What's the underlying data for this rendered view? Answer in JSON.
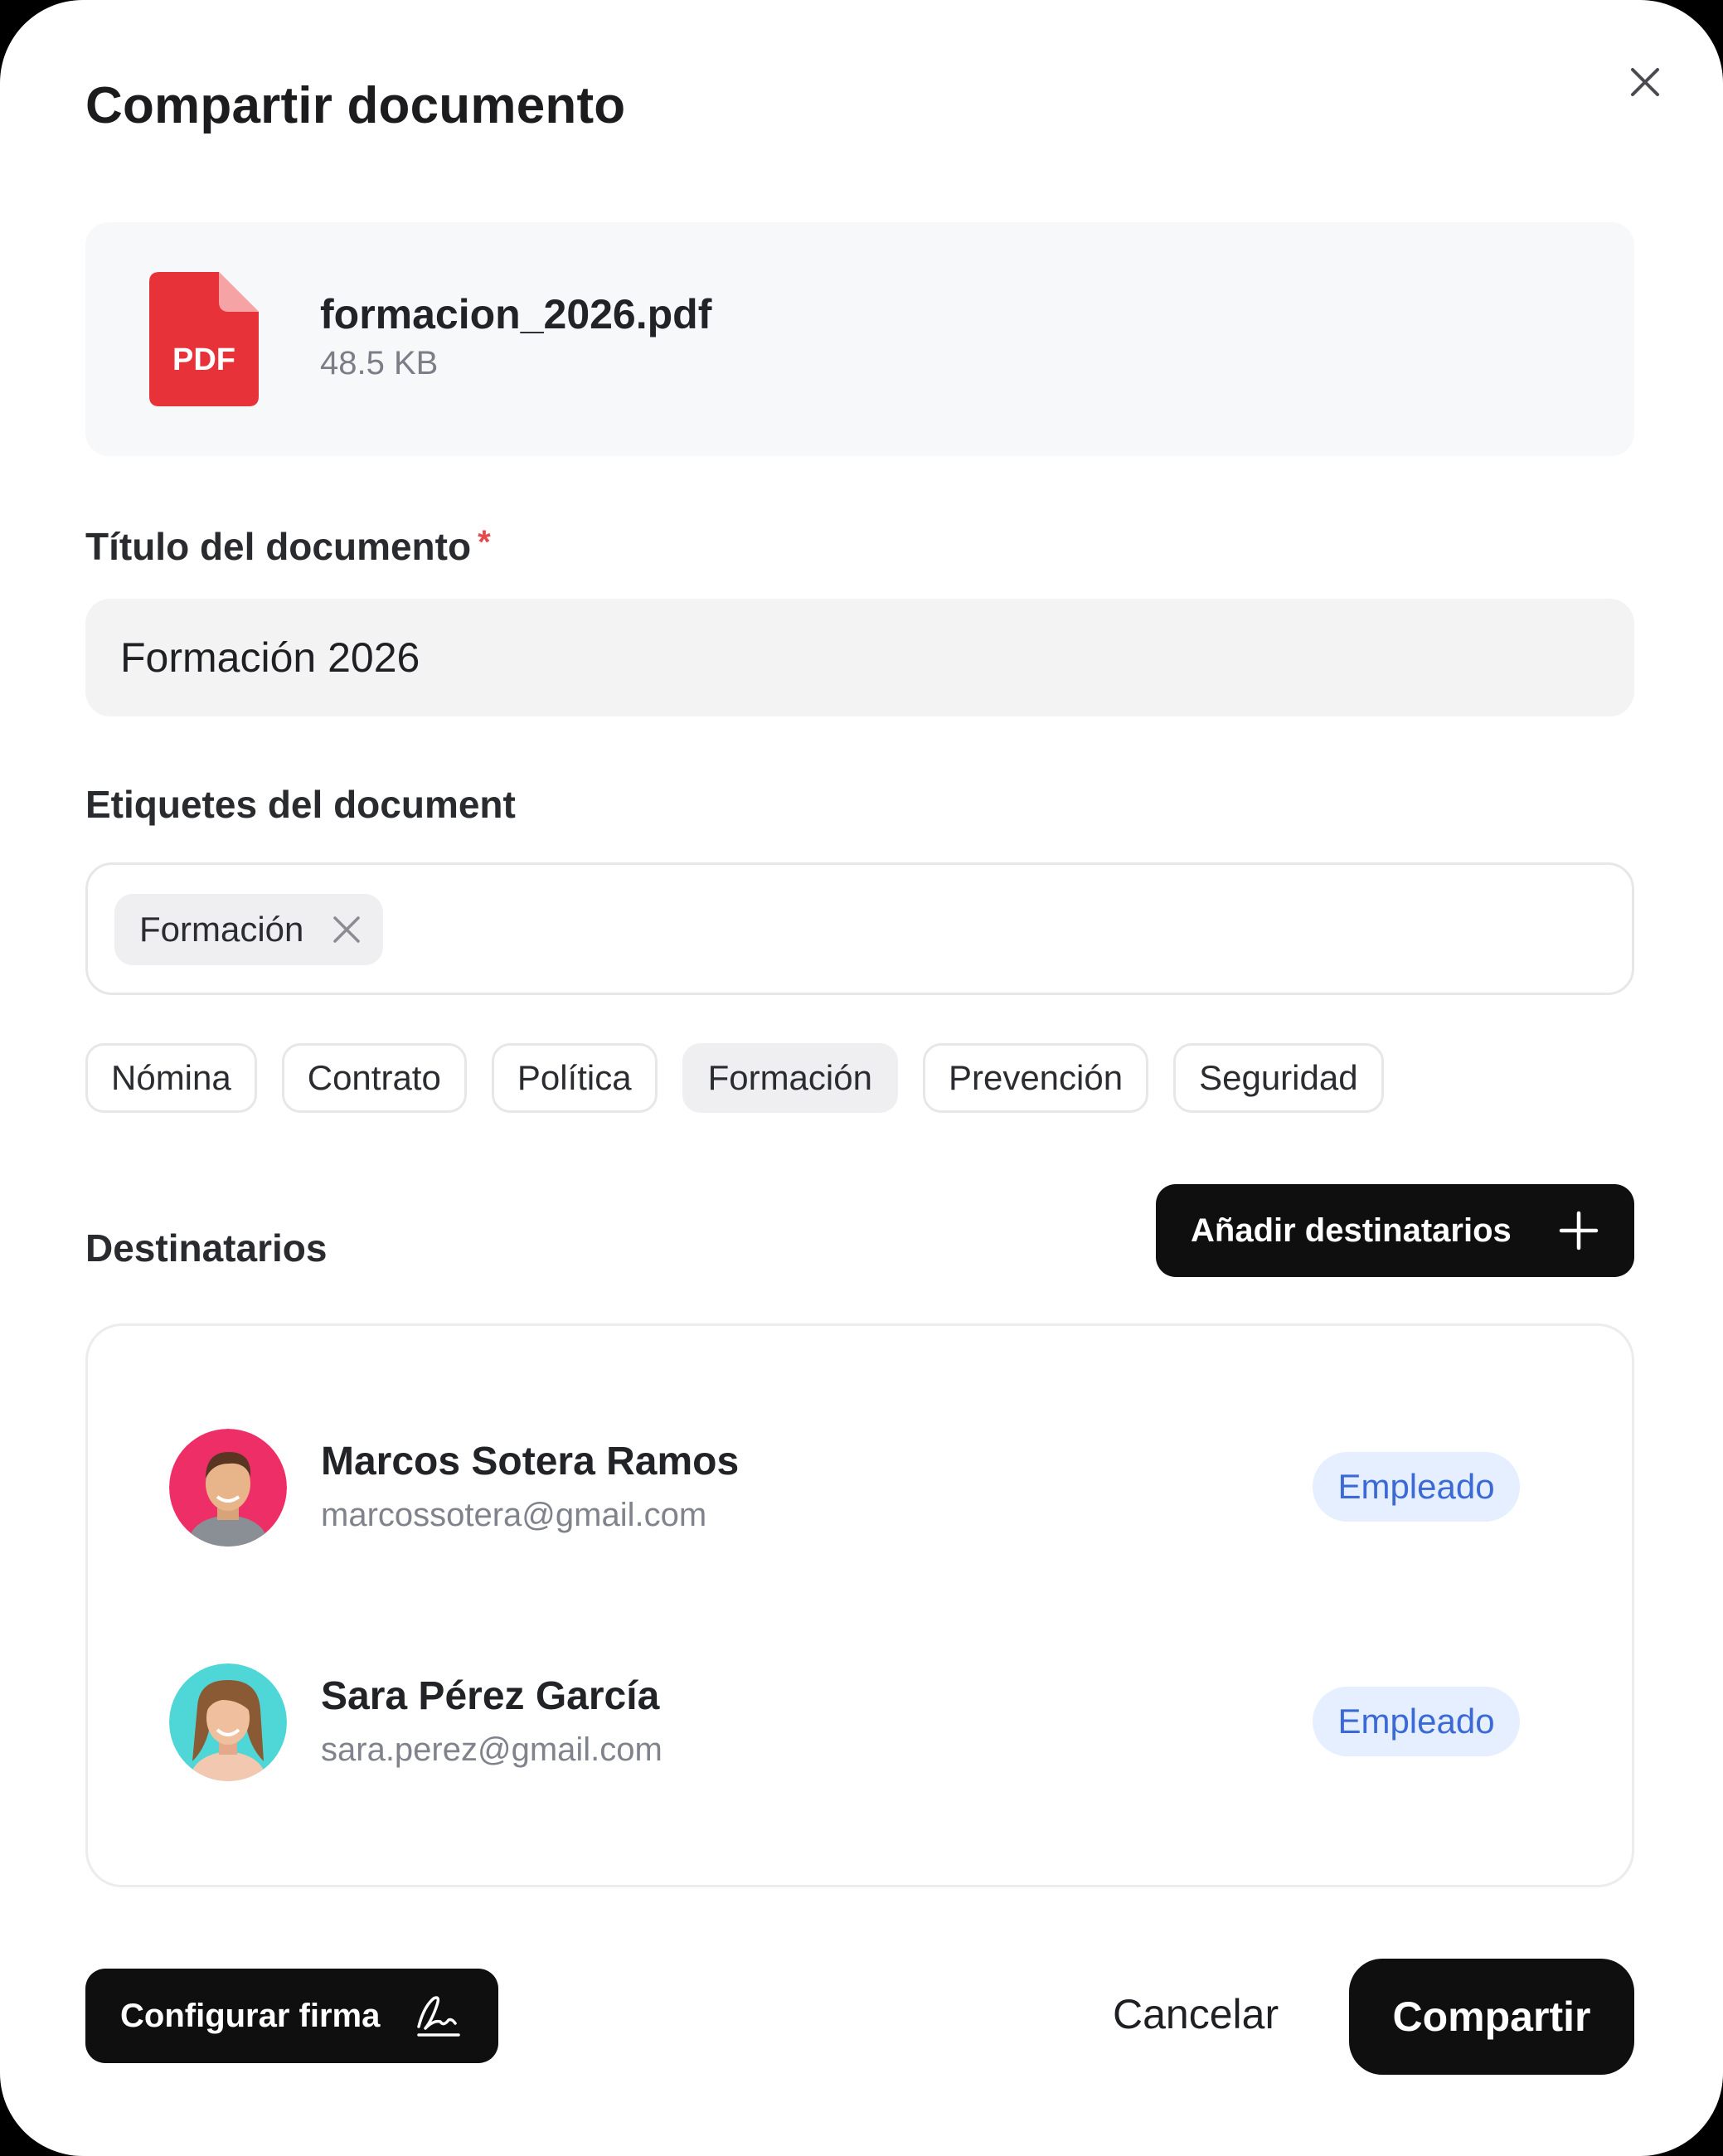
{
  "dialog": {
    "title": "Compartir documento",
    "close_icon": "close-icon"
  },
  "file": {
    "icon_label": "PDF",
    "name": "formacion_2026.pdf",
    "size": "48.5 KB",
    "icon_color": "#e8323a"
  },
  "title_field": {
    "label": "Título del documento",
    "required_mark": "*",
    "value": "Formación 2026"
  },
  "tags": {
    "label": "Etiquetes del document",
    "selected": [
      {
        "label": "Formación"
      }
    ],
    "suggestions": [
      {
        "label": "Nómina",
        "active": false
      },
      {
        "label": "Contrato",
        "active": false
      },
      {
        "label": "Política",
        "active": false
      },
      {
        "label": "Formación",
        "active": true
      },
      {
        "label": "Prevención",
        "active": false
      },
      {
        "label": "Seguridad",
        "active": false
      }
    ]
  },
  "recipients": {
    "label": "Destinatarios",
    "add_button": "Añadir destinatarios",
    "list": [
      {
        "name": "Marcos Sotera Ramos",
        "email": "marcossotera@gmail.com",
        "role": "Empleado",
        "avatar_color": "#ee2f67"
      },
      {
        "name": "Sara Pérez García",
        "email": "sara.perez@gmail.com",
        "role": "Empleado",
        "avatar_color": "#4fd6d6"
      }
    ]
  },
  "footer": {
    "signature_button": "Configurar firma",
    "cancel": "Cancelar",
    "share": "Compartir"
  },
  "colors": {
    "primary_button": "#0f0f10",
    "badge_bg": "#e6efff",
    "badge_text": "#3b69d6",
    "required": "#e5484d"
  }
}
